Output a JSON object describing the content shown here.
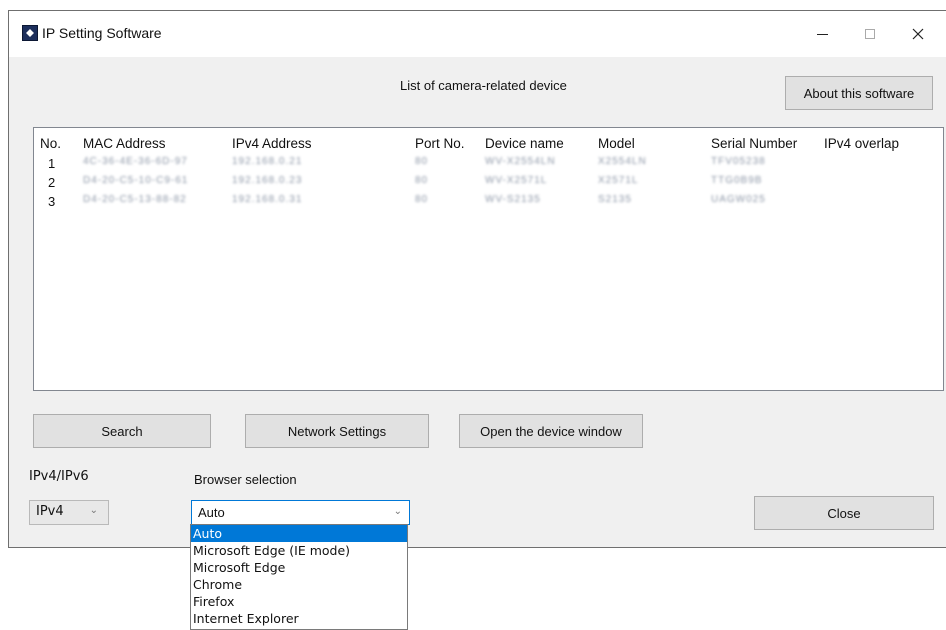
{
  "window": {
    "title": "IP Setting Software",
    "icon": "camera-app-icon"
  },
  "controls": {
    "minimize": "–",
    "maximize": "□",
    "close": "✕"
  },
  "list": {
    "caption": "List of camera-related device",
    "columns": [
      "No.",
      "MAC Address",
      "IPv4 Address",
      "Port No.",
      "Device name",
      "Model",
      "Serial Number",
      "IPv4 overlap"
    ],
    "rows": [
      {
        "no": "1",
        "mac": "4C-36-4E-36-6D-97",
        "ip": "192.168.0.21",
        "port": "80",
        "name": "WV-X2554LN",
        "model": "X2554LN",
        "serial": "TFV05238",
        "overlap": ""
      },
      {
        "no": "2",
        "mac": "D4-20-C5-10-C9-61",
        "ip": "192.168.0.23",
        "port": "80",
        "name": "WV-X2571L",
        "model": "X2571L",
        "serial": "TTG0B9B",
        "overlap": ""
      },
      {
        "no": "3",
        "mac": "D4-20-C5-13-88-82",
        "ip": "192.168.0.31",
        "port": "80",
        "name": "WV-S2135",
        "model": "S2135",
        "serial": "UAGW025",
        "overlap": ""
      }
    ]
  },
  "buttons": {
    "about": "About this software",
    "search": "Search",
    "network": "Network Settings",
    "open_device": "Open the device window",
    "close": "Close"
  },
  "ipv": {
    "label": "IPv4/IPv6",
    "value": "IPv4"
  },
  "browser": {
    "label": "Browser selection",
    "value": "Auto",
    "options": [
      "Auto",
      "Microsoft Edge (IE mode)",
      "Microsoft Edge",
      "Chrome",
      "Firefox",
      "Internet Explorer"
    ],
    "selected_index": 0
  },
  "colors": {
    "accent": "#0078d7",
    "window_bg": "#f0f0f0",
    "button_bg": "#e1e1e1"
  }
}
